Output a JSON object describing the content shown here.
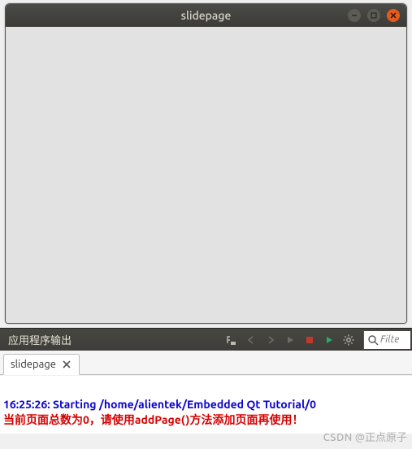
{
  "window": {
    "title": "slidepage"
  },
  "outputPanel": {
    "title": "应用程序输出"
  },
  "filter": {
    "placeholder": "Filte"
  },
  "tabs": [
    {
      "label": "slidepage"
    }
  ],
  "console": {
    "start": "16:25:26: Starting /home/alientek/Embedded Qt Tutorial/0",
    "warn": "当前页面总数为0，请使用addPage()方法添加页面再使用！"
  },
  "watermark": {
    "csdn": "CSDN",
    "author": "@正点原子"
  }
}
